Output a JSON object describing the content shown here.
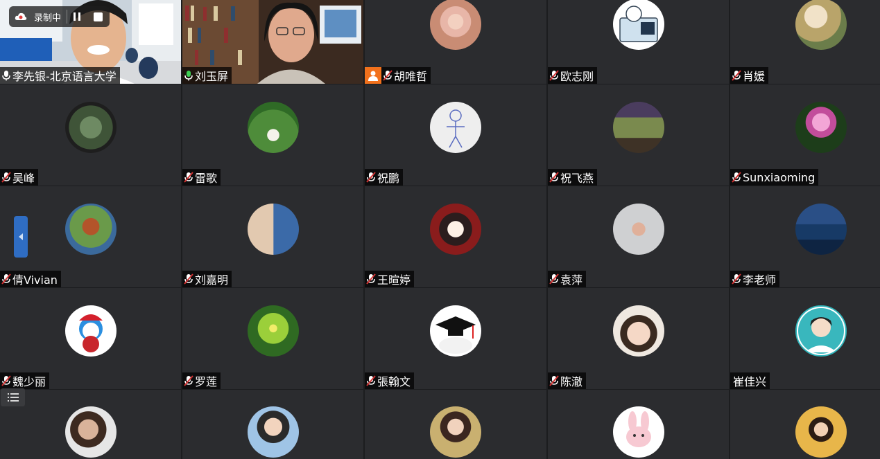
{
  "recording": {
    "status_label": "录制中"
  },
  "participants": [
    {
      "name": "李先银-北京语言大学",
      "mic": "active"
    },
    {
      "name": "刘玉屏",
      "mic": "active"
    },
    {
      "name": "胡唯哲",
      "mic": "muted",
      "badge": "person-icon"
    },
    {
      "name": "欧志刚",
      "mic": "muted"
    },
    {
      "name": "肖媛",
      "mic": "muted"
    },
    {
      "name": "吴峰",
      "mic": "muted"
    },
    {
      "name": "雷歌",
      "mic": "muted"
    },
    {
      "name": "祝鹏",
      "mic": "muted"
    },
    {
      "name": "祝飞燕",
      "mic": "muted"
    },
    {
      "name": "Sunxiaoming",
      "mic": "muted"
    },
    {
      "name": "倩Vivian",
      "mic": "muted"
    },
    {
      "name": "刘嘉明",
      "mic": "muted"
    },
    {
      "name": "王暄婷",
      "mic": "muted"
    },
    {
      "name": "袁萍",
      "mic": "muted"
    },
    {
      "name": "李老师",
      "mic": "muted"
    },
    {
      "name": "魏少丽",
      "mic": "muted"
    },
    {
      "name": "罗莲",
      "mic": "muted"
    },
    {
      "name": "張翰文",
      "mic": "muted"
    },
    {
      "name": "陈澈",
      "mic": "muted"
    },
    {
      "name": "崔佳兴",
      "mic": "none"
    },
    {
      "name": "",
      "mic": "none"
    },
    {
      "name": "",
      "mic": "none"
    },
    {
      "name": "",
      "mic": "none"
    },
    {
      "name": "",
      "mic": "none"
    },
    {
      "name": "",
      "mic": "none"
    }
  ],
  "colors": {
    "tile_bg": "#2b2c2f",
    "grid_bg": "#1c1d1f",
    "mic_active": "#3ecf54",
    "mic_muted": "#d13232",
    "badge_orange": "#f2711c",
    "side_toggle": "#2f6dc3"
  }
}
